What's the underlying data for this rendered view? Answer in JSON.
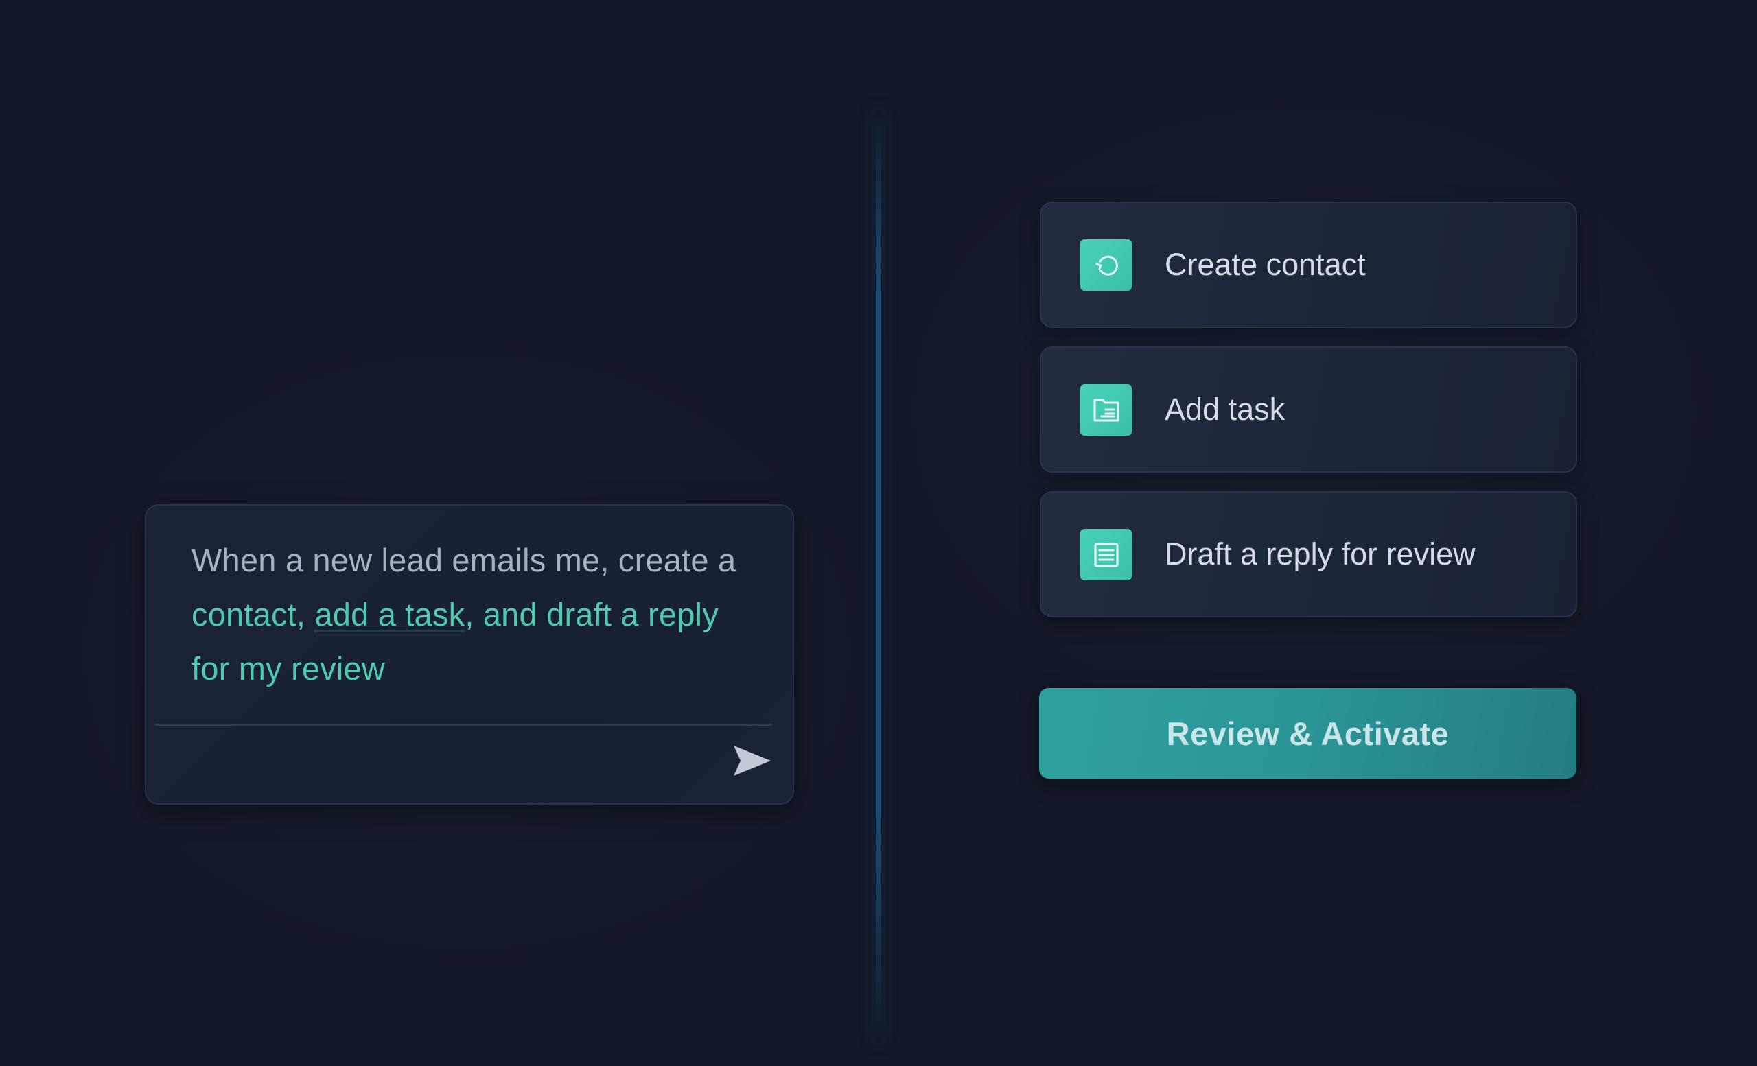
{
  "prompt": {
    "segments": {
      "s1": "When a new lead emails me, create a ",
      "s2": "contact, ",
      "s3": "add a task",
      "s4": ", and draft a reply for my review"
    },
    "send_icon": "send-arrow-icon"
  },
  "actions": [
    {
      "label": "Create contact",
      "icon": "refresh-icon"
    },
    {
      "label": "Add task",
      "icon": "folder-list-icon"
    },
    {
      "label": "Draft a reply for review",
      "icon": "document-lines-icon"
    }
  ],
  "activate": {
    "label": "Review & Activate"
  },
  "colors": {
    "background": "#131826",
    "accent": "#4ec9b3",
    "button": "#2b9496",
    "text_muted": "#a9b1c2",
    "text_primary": "#d6dbe6"
  }
}
